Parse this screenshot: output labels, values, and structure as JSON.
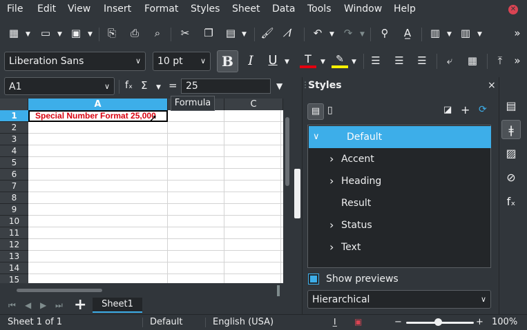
{
  "menu": [
    "File",
    "Edit",
    "View",
    "Insert",
    "Format",
    "Styles",
    "Sheet",
    "Data",
    "Tools",
    "Window",
    "Help"
  ],
  "format_bar": {
    "font_name": "Liberation Sans",
    "font_size": "10 pt",
    "bold": "B",
    "italic": "I",
    "underline": "U",
    "font_color": "#e3000f",
    "highlight_color": "#fff200"
  },
  "formula_bar": {
    "name_box": "A1",
    "fx": "fₓ",
    "sigma": "Σ",
    "equals": "=",
    "value": "25",
    "tooltip": "Formula"
  },
  "grid": {
    "columns": [
      "A",
      "B",
      "C"
    ],
    "rows": [
      "1",
      "2",
      "3",
      "4",
      "5",
      "6",
      "7",
      "8",
      "9",
      "10",
      "11",
      "12",
      "13",
      "14",
      "15"
    ],
    "a1_text": "Special Number Format 25,000"
  },
  "sheet_tabs": {
    "active": "Sheet1",
    "add": "+"
  },
  "sidebar": {
    "title": "Styles",
    "close": "×",
    "styles": [
      {
        "label": "Default",
        "expander": "∨"
      },
      {
        "label": "Accent",
        "expander": "›"
      },
      {
        "label": "Heading",
        "expander": "›"
      },
      {
        "label": "Result",
        "expander": ""
      },
      {
        "label": "Status",
        "expander": "›"
      },
      {
        "label": "Text",
        "expander": "›"
      }
    ],
    "show_previews": "Show previews",
    "filter": "Hierarchical"
  },
  "status": {
    "sheet": "Sheet 1 of 1",
    "page_style": "Default",
    "language": "English (USA)",
    "zoom_minus": "−",
    "zoom_plus": "+",
    "zoom": "100%",
    "zoom_level": 1.0
  }
}
